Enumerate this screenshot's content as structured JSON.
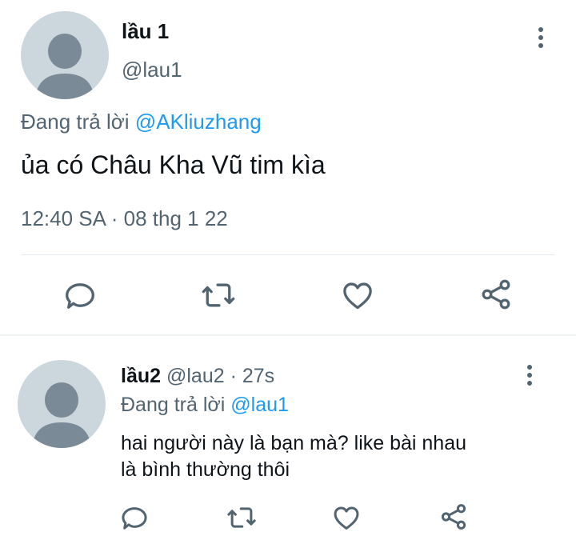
{
  "main_tweet": {
    "display_name": "lầu 1",
    "handle": "@lau1",
    "replying_prefix": "Đang trả lời",
    "replying_to": "@AKliuzhang",
    "text": "ủa có Châu Kha Vũ tim kìa",
    "timestamp": "12:40 SA · 08 thg 1 22",
    "avatar_icon": "default-profile-icon",
    "menu_icon": "more-vertical-icon",
    "actions": [
      "reply-icon",
      "retweet-icon",
      "like-icon",
      "share-icon"
    ]
  },
  "reply_tweet": {
    "display_name": "lầu2",
    "handle": "@lau2",
    "age": "· 27s",
    "replying_prefix": "Đang trả lời",
    "replying_to": "@lau1",
    "text_line1": "hai người này là bạn mà? like bài nhau",
    "text_line2": "là bình thường thôi",
    "avatar_icon": "default-profile-icon",
    "menu_icon": "more-vertical-icon",
    "actions": [
      "reply-icon",
      "retweet-icon",
      "like-icon",
      "share-icon"
    ]
  },
  "colors": {
    "text": "#0f1419",
    "secondary": "#536471",
    "link": "#1d9bf0",
    "avatar_bg": "#ccd6dd",
    "avatar_fg": "#7b8a97"
  }
}
